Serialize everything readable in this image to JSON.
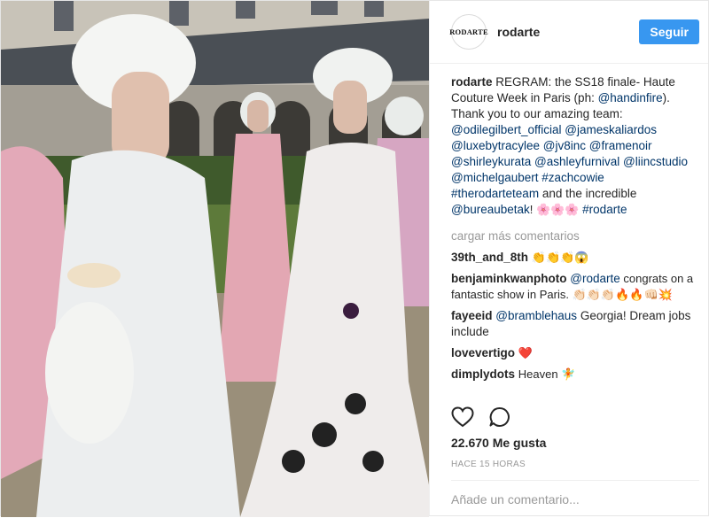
{
  "account": {
    "avatar_text": "RODARTE",
    "username": "rodarte",
    "follow_label": "Seguir"
  },
  "caption": {
    "user": "rodarte",
    "text_1": "REGRAM: the SS18 finale- Haute Couture Week in Paris (ph: ",
    "mention_ph": "@handinfire",
    "text_2": "). Thank you to our amazing team: ",
    "m1": "@odilegilbert_official",
    "m2": "@jameskaliardos",
    "m3": "@luxebytracylee",
    "m4": "@jv8inc",
    "m5": "@framenoir",
    "m6": "@shirleykurata",
    "m7": "@ashleyfurnival",
    "m8": "@liincstudio",
    "m9": "@michelgaubert",
    "m10": "#zachcowie",
    "m11": "#therodarteteam",
    "text_3": " and the incredible ",
    "m12": "@bureaubetak",
    "text_4": "! 🌸🌸🌸 ",
    "m13": "#rodarte"
  },
  "load_more": "cargar más comentarios",
  "comments": [
    {
      "user": "39th_and_8th",
      "text": "👏👏👏😱"
    },
    {
      "user": "benjaminkwanphoto",
      "mention": "@rodarte",
      "text": " congrats on a fantastic show in Paris. 👏🏻👏🏻👏🏻🔥🔥👊🏻💥"
    },
    {
      "user": "fayeeid",
      "mention": "@bramblehaus",
      "text": " Georgia! Dream jobs include"
    },
    {
      "user": "lovevertigo",
      "text": "❤️"
    },
    {
      "user": "dimplydots",
      "text": "Heaven 🧚"
    }
  ],
  "likes": "22.670 Me gusta",
  "time": "HACE 15 HORAS",
  "add_comment_placeholder": "Añade un comentario...",
  "icons": {
    "like": "heart-outline-icon",
    "comment": "speech-bubble-icon"
  }
}
